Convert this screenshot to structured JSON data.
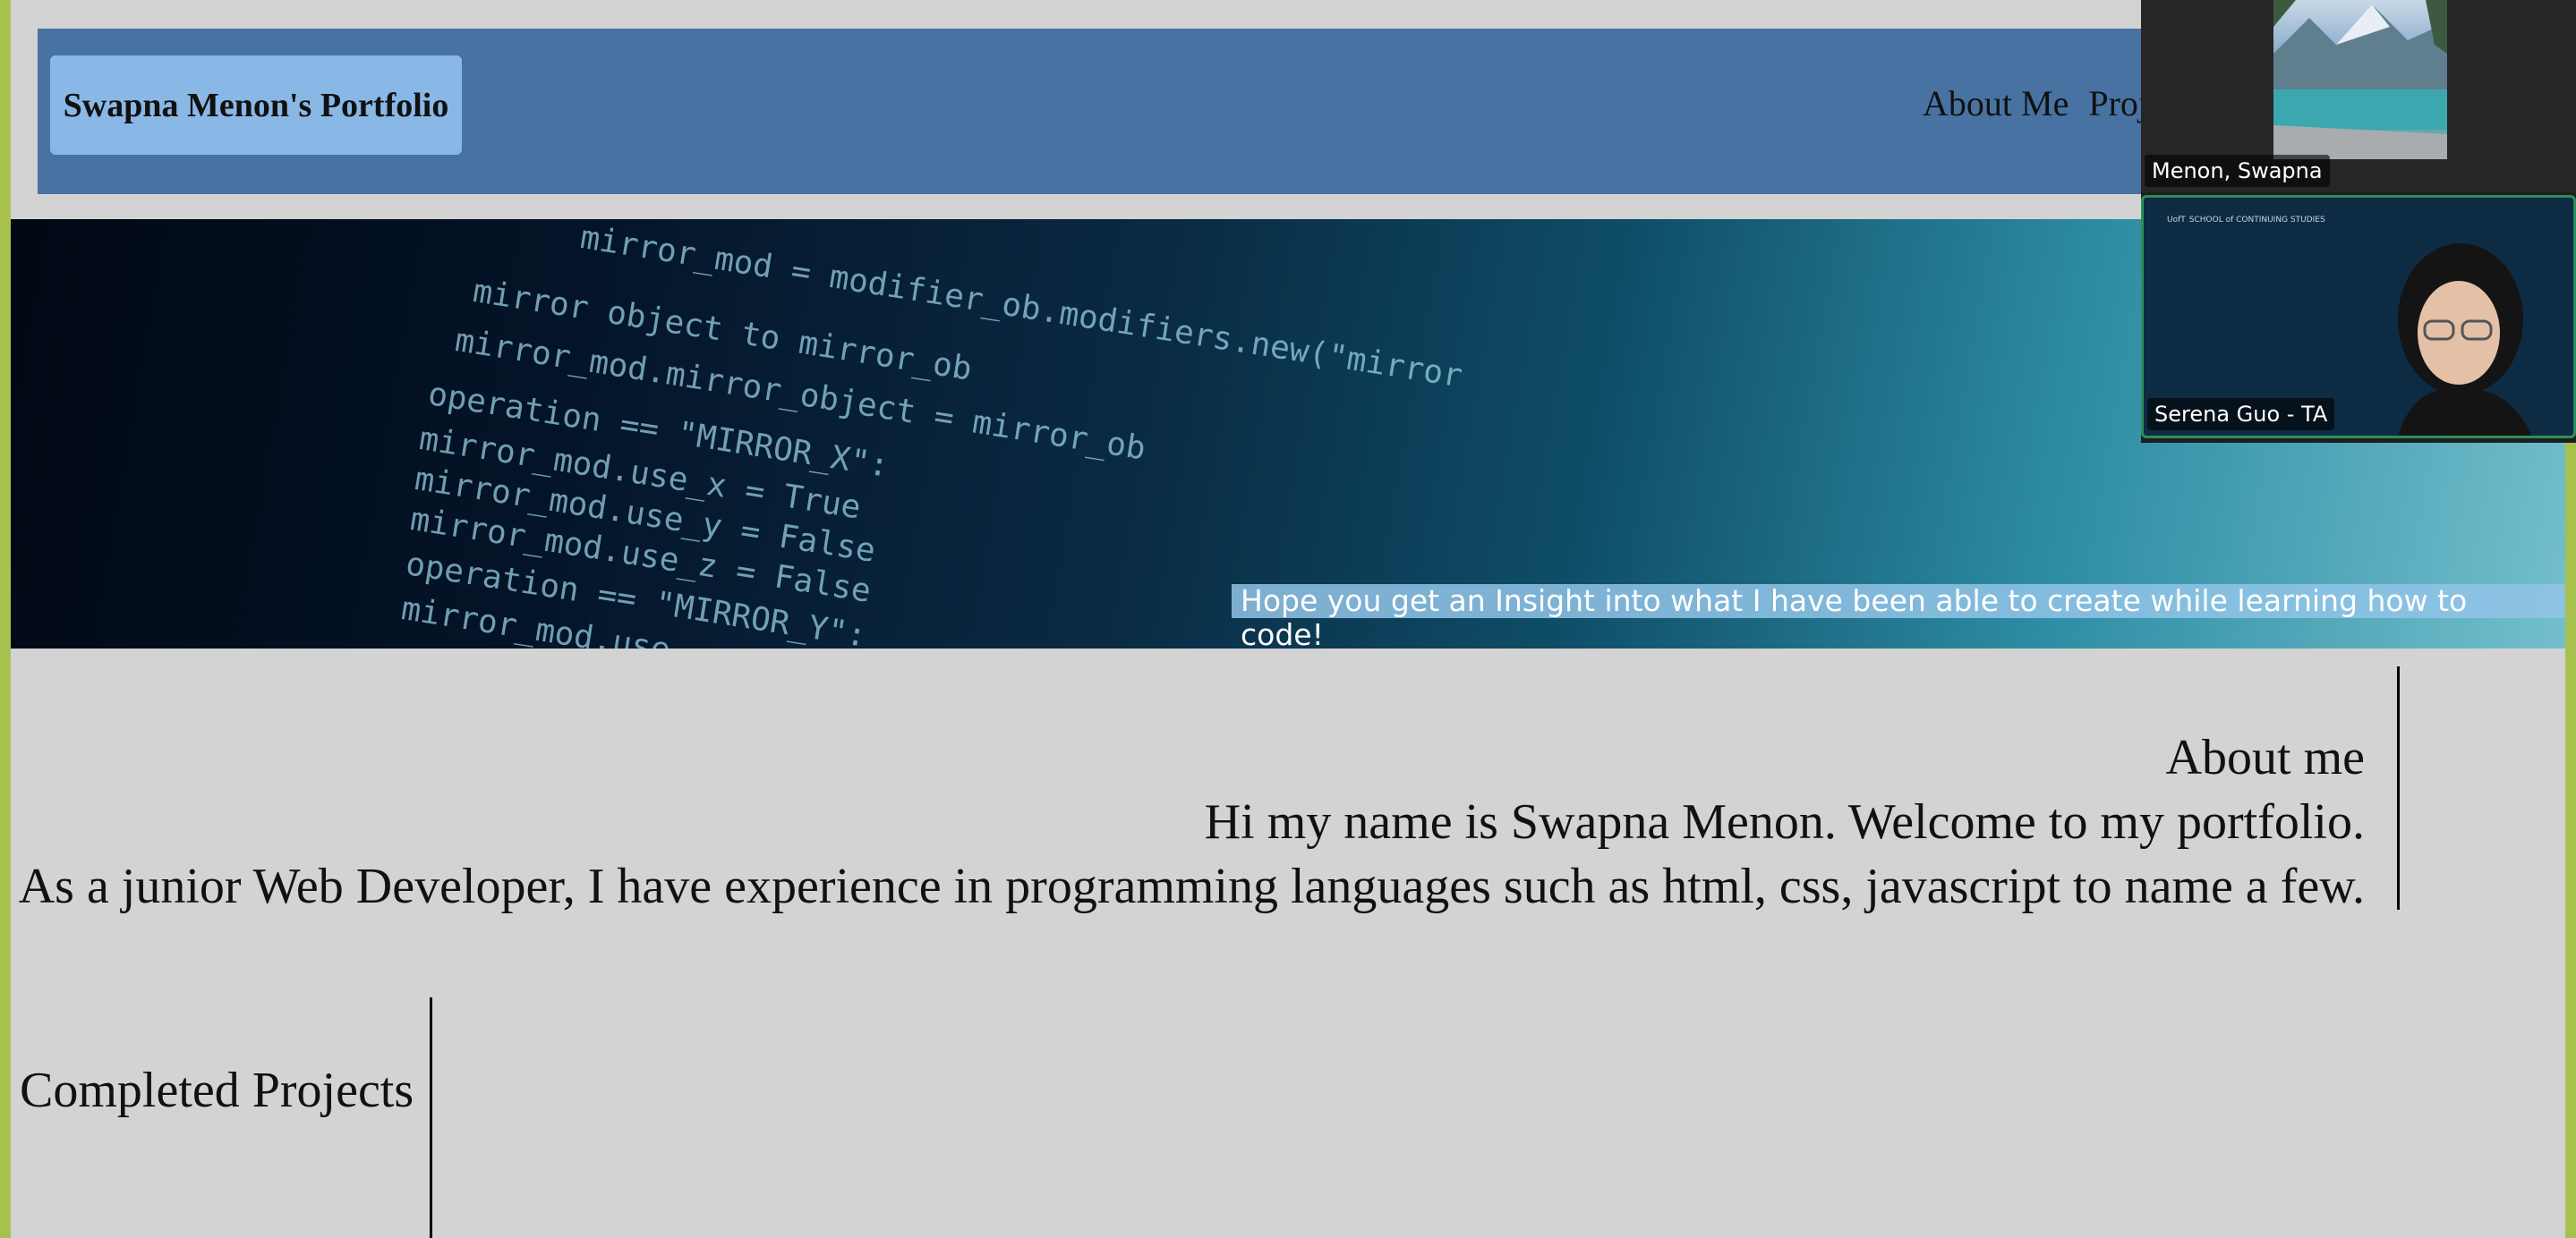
{
  "header": {
    "brand": "Swapna Menon's Portfolio",
    "nav": [
      {
        "label": "About Me"
      },
      {
        "label": "Proj"
      }
    ]
  },
  "hero": {
    "code_lines": [
      "mirror_mod = modifier_ob.modifiers.new(\"mirror",
      "mirror object to mirror_ob",
      "mirror_mod.mirror_object = mirror_ob",
      "operation == \"MIRROR_X\":",
      "mirror_mod.use_x = True",
      "mirror_mod.use_y = False",
      "mirror_mod.use_z = False",
      "operation == \"MIRROR_Y\":",
      "mirror_mod.use"
    ],
    "tagline": "Hope you get an Insight into what I have been able to create while learning how to code!"
  },
  "about": {
    "heading": "About me",
    "line1": "Hi my name is Swapna Menon. Welcome to my portfolio.",
    "line2": "As a junior Web Developer, I have experience in programming languages such as html, css, javascript to name a few."
  },
  "projects": {
    "heading": "Completed Projects"
  },
  "video_call": {
    "participants": [
      {
        "name": "Menon, Swapna"
      },
      {
        "name": "Serena Guo - TA"
      }
    ],
    "logo_text": "UofT",
    "logo_sub": "SCHOOL of CONTINUING STUDIES"
  }
}
